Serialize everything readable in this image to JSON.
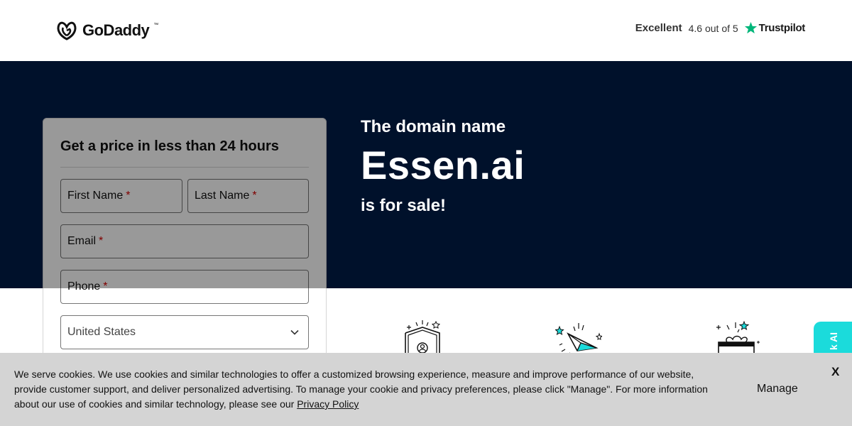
{
  "header": {
    "brand": "GoDaddy",
    "brand_tm": "™",
    "rating": {
      "label": "Excellent",
      "score_text": "4.6 out of 5",
      "provider": "Trustpilot",
      "provider_color": "#00b67a"
    }
  },
  "hero": {
    "line1": "The domain name",
    "domain": "Essen.ai",
    "line3": "is for sale!",
    "background": "#00112b"
  },
  "form": {
    "title": "Get a price in less than 24 hours",
    "required_mark": "*",
    "fields": {
      "first_name": "First Name",
      "last_name": "Last Name",
      "email": "Email",
      "phone": "Phone"
    },
    "country": {
      "selected": "United States"
    }
  },
  "feature_icons": [
    "shield-user-icon",
    "paper-plane-icon",
    "gift-box-icon"
  ],
  "side_tab": {
    "label": "k AI",
    "color": "#1bdbdb"
  },
  "cookie_banner": {
    "text": "We serve cookies. We use cookies and similar technologies to offer a customized browsing experience, measure and improve performance of our website, provide customer support, and deliver personalized advertising. To manage your cookie and privacy preferences, please click \"Manage\". For more information about our use of cookies and similar technology, please see our ",
    "link_text": "Privacy Policy",
    "manage_label": "Manage",
    "close_label": "X"
  }
}
